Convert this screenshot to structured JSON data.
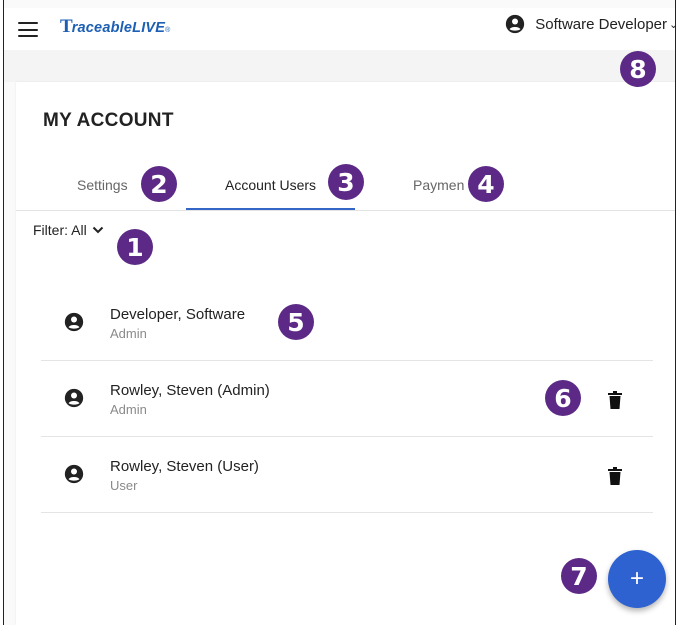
{
  "app": {
    "logo_mark": "T",
    "logo_text": "raceableLIVE",
    "logo_reg": "®"
  },
  "header": {
    "user_name": "Software Developer",
    "user_chevron": "⌄"
  },
  "page": {
    "title": "MY ACCOUNT"
  },
  "tabs": [
    {
      "label": "Settings",
      "active": false
    },
    {
      "label": "Account Users",
      "active": true
    },
    {
      "label": "Paymen",
      "active": false
    }
  ],
  "filter": {
    "label": "Filter: All"
  },
  "users": [
    {
      "name": "Developer, Software",
      "role": "Admin",
      "deletable": false
    },
    {
      "name": "Rowley, Steven (Admin)",
      "role": "Admin",
      "deletable": true
    },
    {
      "name": "Rowley, Steven (User)",
      "role": "User",
      "deletable": true
    }
  ],
  "fab": {
    "label": "+"
  },
  "callouts": [
    "1",
    "2",
    "3",
    "4",
    "5",
    "6",
    "7",
    "8"
  ],
  "colors": {
    "brand": "#1c5fb4",
    "accent": "#3466c8",
    "fab": "#2e62d0",
    "callout": "#5c2a86"
  },
  "icons": {
    "menu": "hamburger-icon",
    "user": "account-circle-icon",
    "filter": "chevron-down-icon",
    "delete": "trash-icon",
    "add": "plus-icon"
  }
}
